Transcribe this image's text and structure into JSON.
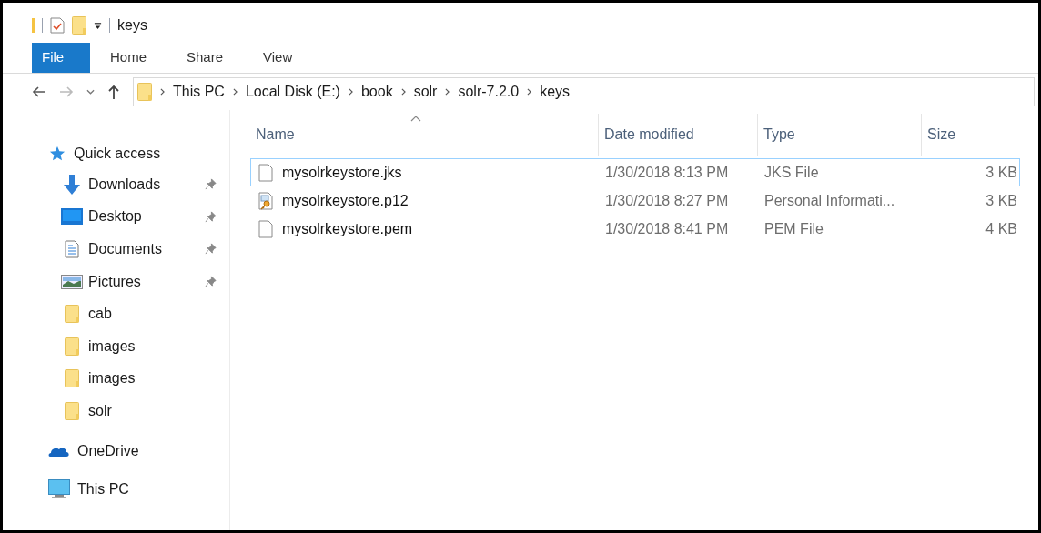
{
  "window": {
    "title": "keys"
  },
  "ribbon_tabs": [
    {
      "label": "File",
      "selected": true
    },
    {
      "label": "Home",
      "selected": false
    },
    {
      "label": "Share",
      "selected": false
    },
    {
      "label": "View",
      "selected": false
    }
  ],
  "address_bar": {
    "path": [
      "This PC",
      "Local Disk (E:)",
      "book",
      "solr",
      "solr-7.2.0",
      "keys"
    ]
  },
  "sidebar": {
    "items": [
      {
        "label": "Quick access",
        "kind": "star",
        "children": [
          {
            "label": "Downloads",
            "kind": "download",
            "pinned": true
          },
          {
            "label": "Desktop",
            "kind": "desktop",
            "pinned": true
          },
          {
            "label": "Documents",
            "kind": "document",
            "pinned": true
          },
          {
            "label": "Pictures",
            "kind": "pictures",
            "pinned": true
          },
          {
            "label": "cab",
            "kind": "folder",
            "pinned": false
          },
          {
            "label": "images",
            "kind": "folder",
            "pinned": false
          },
          {
            "label": "images",
            "kind": "folder",
            "pinned": false
          },
          {
            "label": "solr",
            "kind": "folder",
            "pinned": false
          }
        ]
      },
      {
        "label": "OneDrive",
        "kind": "cloud"
      },
      {
        "label": "This PC",
        "kind": "pc"
      }
    ]
  },
  "table": {
    "columns": [
      {
        "label": "Name",
        "sorted": true
      },
      {
        "label": "Date modified",
        "sorted": false
      },
      {
        "label": "Type",
        "sorted": false
      },
      {
        "label": "Size",
        "sorted": false
      }
    ],
    "rows": [
      {
        "name": "mysolrkeystore.jks",
        "kind": "file",
        "date": "1/30/2018 8:13 PM",
        "type": "JKS File",
        "size": "3 KB",
        "selected": true
      },
      {
        "name": "mysolrkeystore.p12",
        "kind": "certificate",
        "date": "1/30/2018 8:27 PM",
        "type": "Personal Informati...",
        "size": "3 KB",
        "selected": false
      },
      {
        "name": "mysolrkeystore.pem",
        "kind": "file",
        "date": "1/30/2018 8:41 PM",
        "type": "PEM File",
        "size": "4 KB",
        "selected": false
      }
    ]
  }
}
